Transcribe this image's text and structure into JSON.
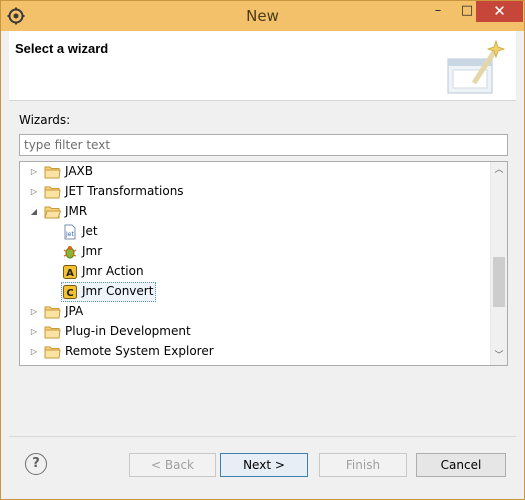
{
  "window": {
    "title": "New",
    "minimize": "–",
    "maximize": "□",
    "close": "✕"
  },
  "header": {
    "title": "Select a wizard"
  },
  "wizards_label": "Wizards:",
  "filter": {
    "placeholder": "type filter text",
    "value": ""
  },
  "tree": {
    "items": [
      {
        "label": "JAXB",
        "type": "folder",
        "expanded": false
      },
      {
        "label": "JET Transformations",
        "type": "folder",
        "expanded": false
      },
      {
        "label": "JMR",
        "type": "folder",
        "expanded": true
      },
      {
        "label": "Jet",
        "type": "leaf",
        "icon": "jet-file-icon"
      },
      {
        "label": "Jmr",
        "type": "leaf",
        "icon": "jmr-bug-icon"
      },
      {
        "label": "Jmr Action",
        "type": "leaf",
        "icon": "jmr-action-icon"
      },
      {
        "label": "Jmr Convert",
        "type": "leaf",
        "icon": "jmr-convert-icon",
        "selected": true
      },
      {
        "label": "JPA",
        "type": "folder",
        "expanded": false
      },
      {
        "label": "Plug-in Development",
        "type": "folder",
        "expanded": false
      },
      {
        "label": "Remote System Explorer",
        "type": "folder",
        "expanded": false
      }
    ]
  },
  "buttons": {
    "help": "?",
    "back": "< Back",
    "next": "Next >",
    "finish": "Finish",
    "cancel": "Cancel"
  },
  "colors": {
    "titlebar": "#f3c16a",
    "close": "#c7463a",
    "selection": "#eef4fc"
  }
}
